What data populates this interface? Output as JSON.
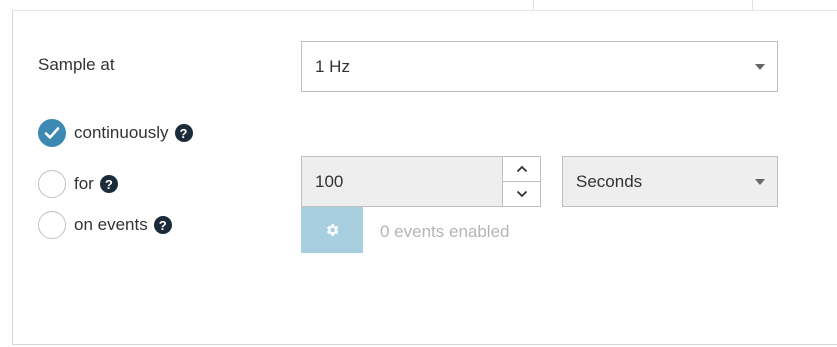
{
  "sample_label": "Sample at",
  "sample_rate": {
    "value": "1 Hz"
  },
  "mode": {
    "options": [
      {
        "label": "continuously",
        "checked": true,
        "help": "?"
      },
      {
        "label": "for",
        "checked": false,
        "help": "?"
      },
      {
        "label": "on events",
        "checked": false,
        "help": "?"
      }
    ]
  },
  "duration": {
    "value": "100",
    "unit": "Seconds"
  },
  "events": {
    "status": "0 events enabled"
  },
  "colors": {
    "accent": "#3c89b3",
    "disabled_button": "#a8cfe0"
  }
}
